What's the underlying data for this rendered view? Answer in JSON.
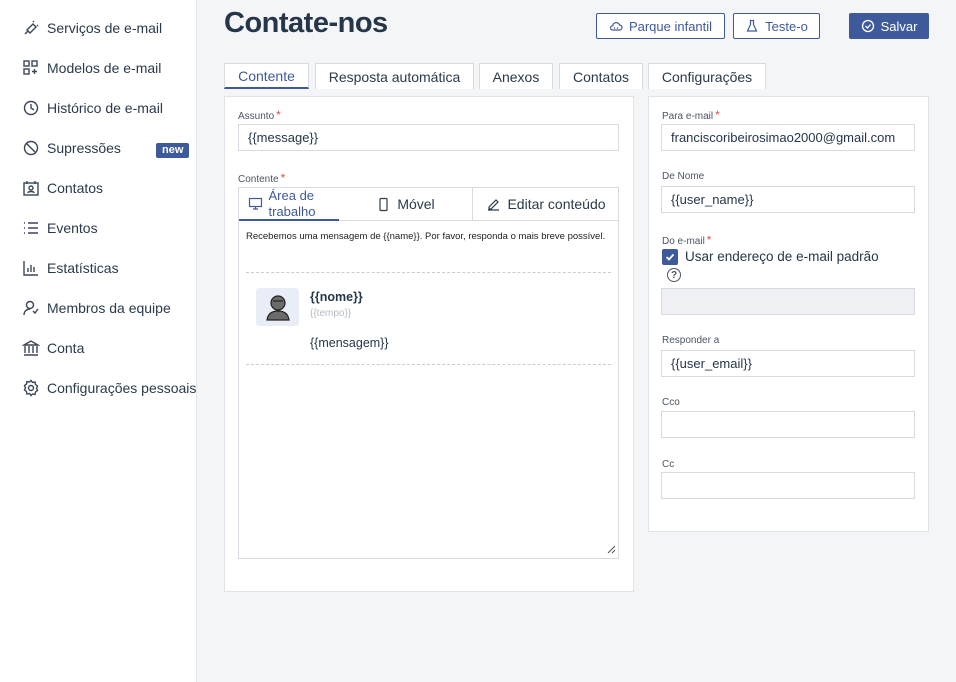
{
  "sidebar": {
    "items": [
      {
        "label": "Serviços de e-mail",
        "icon": "plug-icon"
      },
      {
        "label": "Modelos de e-mail",
        "icon": "templates-icon"
      },
      {
        "label": "Histórico de e-mail",
        "icon": "history-icon"
      },
      {
        "label": "Supressões",
        "icon": "ban-icon"
      },
      {
        "label": "Contatos",
        "icon": "contacts-icon"
      },
      {
        "label": "Eventos",
        "icon": "list-icon"
      },
      {
        "label": "Estatísticas",
        "icon": "bar-chart-icon"
      },
      {
        "label": "Membros da equipe",
        "icon": "team-icon"
      },
      {
        "label": "Conta",
        "icon": "bank-icon"
      },
      {
        "label": "Configurações pessoais",
        "icon": "gear-icon"
      }
    ],
    "new_badge": "new"
  },
  "header": {
    "title": "Contate-nos",
    "playground_label": "Parque infantil",
    "test_label": "Teste-o",
    "save_label": "Salvar"
  },
  "tabs": [
    "Contente",
    "Resposta automática",
    "Anexos",
    "Contatos",
    "Configurações"
  ],
  "content": {
    "subject_label": "Assunto",
    "subject_value": "{{message}}",
    "content_label": "Contente",
    "editor_tabs": {
      "desktop": "Área de trabalho",
      "mobile": "Móvel",
      "edit": "Editar conteúdo"
    },
    "preview": {
      "intro": "Recebemos uma mensagem de {{name}}. Por favor, responda o mais breve possível.",
      "name": "{{nome}}",
      "time": "{{tempo}}",
      "message": "{{mensagem}}"
    }
  },
  "settings": {
    "to_email_label": "Para e-mail",
    "to_email_value": "franciscoribeirosimao2000@gmail.com",
    "from_name_label": "De Nome",
    "from_name_value": "{{user_name}}",
    "from_email_label": "Do e-mail",
    "default_email_label": "Usar endereço de e-mail padrão",
    "help_glyph": "?",
    "reply_to_label": "Responder a",
    "reply_to_value": "{{user_email}}",
    "bcc_label": "Cco",
    "cc_label": "Cc"
  },
  "colors": {
    "primary": "#3f5a9b",
    "required": "#d9534f"
  }
}
